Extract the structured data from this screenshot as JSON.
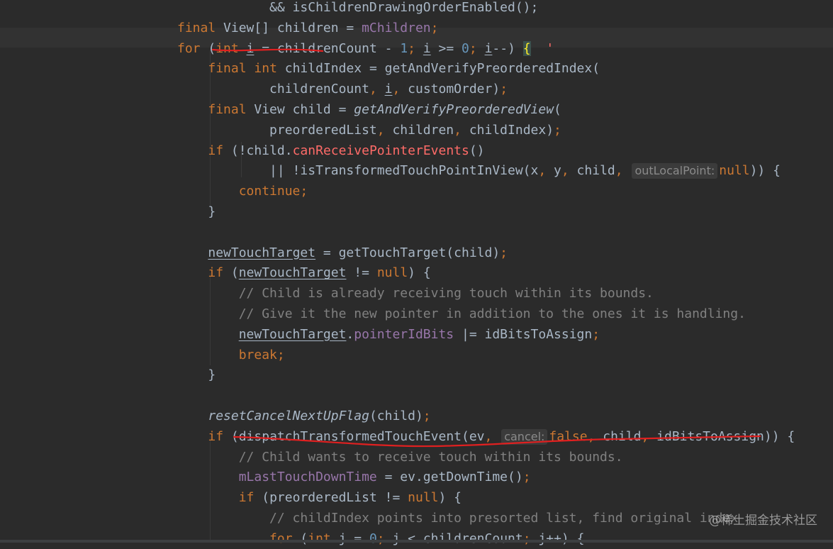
{
  "editor": {
    "lines": [
      {
        "segs": [
          {
            "t": "            && isChildrenDrawingOrderEnabled();"
          }
        ]
      },
      {
        "segs": [
          {
            "t": "final",
            "c": "kw"
          },
          {
            "t": " View[] children = "
          },
          {
            "t": "mChildren",
            "c": "fld"
          },
          {
            "t": ";",
            "c": "kw"
          }
        ]
      },
      {
        "current": true,
        "segs": [
          {
            "t": "for",
            "c": "kw"
          },
          {
            "t": " ("
          },
          {
            "t": "int",
            "c": "kw"
          },
          {
            "t": " "
          },
          {
            "t": "i",
            "c": "ul"
          },
          {
            "t": " = childrenCount - "
          },
          {
            "t": "1",
            "c": "num"
          },
          {
            "t": ";",
            "c": "kw"
          },
          {
            "t": " "
          },
          {
            "t": "i",
            "c": "ul"
          },
          {
            "t": " >= "
          },
          {
            "t": "0",
            "c": "num"
          },
          {
            "t": ";",
            "c": "kw"
          },
          {
            "t": " "
          },
          {
            "t": "i",
            "c": "ul"
          },
          {
            "t": "--) "
          },
          {
            "t": "{",
            "c": "brace-match"
          },
          {
            "t": "  "
          },
          {
            "t": "'",
            "c": "err"
          }
        ]
      },
      {
        "segs": [
          {
            "t": "    "
          },
          {
            "t": "final",
            "c": "kw"
          },
          {
            "t": " "
          },
          {
            "t": "int",
            "c": "kw"
          },
          {
            "t": " childIndex = getAndVerifyPreorderedIndex("
          }
        ]
      },
      {
        "segs": [
          {
            "t": "            childrenCount"
          },
          {
            "t": ",",
            "c": "kw"
          },
          {
            "t": " "
          },
          {
            "t": "i",
            "c": "ul"
          },
          {
            "t": ",",
            "c": "kw"
          },
          {
            "t": " customOrder)"
          },
          {
            "t": ";",
            "c": "kw"
          }
        ]
      },
      {
        "segs": [
          {
            "t": "    "
          },
          {
            "t": "final",
            "c": "kw"
          },
          {
            "t": " View child = "
          },
          {
            "t": "getAndVerifyPreorderedView",
            "c": "it"
          },
          {
            "t": "("
          }
        ]
      },
      {
        "segs": [
          {
            "t": "            preorderedList"
          },
          {
            "t": ",",
            "c": "kw"
          },
          {
            "t": " children"
          },
          {
            "t": ",",
            "c": "kw"
          },
          {
            "t": " childIndex)"
          },
          {
            "t": ";",
            "c": "kw"
          }
        ]
      },
      {
        "segs": [
          {
            "t": "    "
          },
          {
            "t": "if",
            "c": "kw"
          },
          {
            "t": " (!child."
          },
          {
            "t": "canReceivePointerEvents",
            "c": "err"
          },
          {
            "t": "()"
          }
        ]
      },
      {
        "segs": [
          {
            "t": "            || !isTransformedTouchPointInView(x"
          },
          {
            "t": ",",
            "c": "kw"
          },
          {
            "t": " y"
          },
          {
            "t": ",",
            "c": "kw"
          },
          {
            "t": " child"
          },
          {
            "t": ",",
            "c": "kw"
          },
          {
            "t": " "
          },
          {
            "t": "outLocalPoint:",
            "c": "hint"
          },
          {
            "t": "null",
            "c": "kw"
          },
          {
            "t": ")) {"
          }
        ]
      },
      {
        "segs": [
          {
            "t": "        "
          },
          {
            "t": "continue;",
            "c": "kw"
          }
        ]
      },
      {
        "segs": [
          {
            "t": "    }"
          }
        ]
      },
      {
        "segs": [
          {
            "t": ""
          }
        ]
      },
      {
        "segs": [
          {
            "t": "    "
          },
          {
            "t": "newTouchTarget",
            "c": "ul"
          },
          {
            "t": " = getTouchTarget(child)"
          },
          {
            "t": ";",
            "c": "kw"
          }
        ]
      },
      {
        "segs": [
          {
            "t": "    "
          },
          {
            "t": "if",
            "c": "kw"
          },
          {
            "t": " ("
          },
          {
            "t": "newTouchTarget",
            "c": "ul"
          },
          {
            "t": " != "
          },
          {
            "t": "null",
            "c": "kw"
          },
          {
            "t": ") {"
          }
        ]
      },
      {
        "segs": [
          {
            "t": "        // Child is already receiving touch within its bounds.",
            "c": "cmt"
          }
        ]
      },
      {
        "segs": [
          {
            "t": "        // Give it the new pointer in addition to the ones it is handling.",
            "c": "cmt"
          }
        ]
      },
      {
        "segs": [
          {
            "t": "        "
          },
          {
            "t": "newTouchTarget",
            "c": "ul"
          },
          {
            "t": "."
          },
          {
            "t": "pointerIdBits",
            "c": "fld"
          },
          {
            "t": " |= idBitsToAssign"
          },
          {
            "t": ";",
            "c": "kw"
          }
        ]
      },
      {
        "segs": [
          {
            "t": "        "
          },
          {
            "t": "break;",
            "c": "kw"
          }
        ]
      },
      {
        "segs": [
          {
            "t": "    }"
          }
        ]
      },
      {
        "segs": [
          {
            "t": ""
          }
        ]
      },
      {
        "segs": [
          {
            "t": "    "
          },
          {
            "t": "resetCancelNextUpFlag",
            "c": "it"
          },
          {
            "t": "(child)"
          },
          {
            "t": ";",
            "c": "kw"
          }
        ]
      },
      {
        "segs": [
          {
            "t": "    "
          },
          {
            "t": "if",
            "c": "kw"
          },
          {
            "t": " (dispatchTransformedTouchEvent(ev"
          },
          {
            "t": ",",
            "c": "kw"
          },
          {
            "t": " "
          },
          {
            "t": "cancel:",
            "c": "hint"
          },
          {
            "t": "false",
            "c": "kw"
          },
          {
            "t": ",",
            "c": "kw"
          },
          {
            "t": " child"
          },
          {
            "t": ",",
            "c": "kw"
          },
          {
            "t": " idBitsToAssign)) {"
          }
        ]
      },
      {
        "segs": [
          {
            "t": "        // Child wants to receive touch within its bounds.",
            "c": "cmt"
          }
        ]
      },
      {
        "segs": [
          {
            "t": "        "
          },
          {
            "t": "mLastTouchDownTime",
            "c": "fld"
          },
          {
            "t": " = ev.getDownTime()"
          },
          {
            "t": ";",
            "c": "kw"
          }
        ]
      },
      {
        "segs": [
          {
            "t": "        "
          },
          {
            "t": "if",
            "c": "kw"
          },
          {
            "t": " (preorderedList != "
          },
          {
            "t": "null",
            "c": "kw"
          },
          {
            "t": ") {"
          }
        ]
      },
      {
        "segs": [
          {
            "t": "            // childIndex points into presorted list, find original index",
            "c": "cmt"
          }
        ]
      },
      {
        "segs": [
          {
            "t": "            "
          },
          {
            "t": "for",
            "c": "kw"
          },
          {
            "t": " ("
          },
          {
            "t": "int",
            "c": "kw"
          },
          {
            "t": " j = "
          },
          {
            "t": "0",
            "c": "num"
          },
          {
            "t": ";",
            "c": "kw"
          },
          {
            "t": " j < childrenCount"
          },
          {
            "t": ";",
            "c": "kw"
          },
          {
            "t": " j++) {"
          }
        ]
      }
    ]
  },
  "watermark": "@稀土掘金技术社区",
  "colors": {
    "background": "#2b2b2b",
    "keyword": "#cc7832",
    "field": "#9876aa",
    "number": "#6897bb",
    "comment": "#808080",
    "annotation_stroke": "#e02020"
  }
}
